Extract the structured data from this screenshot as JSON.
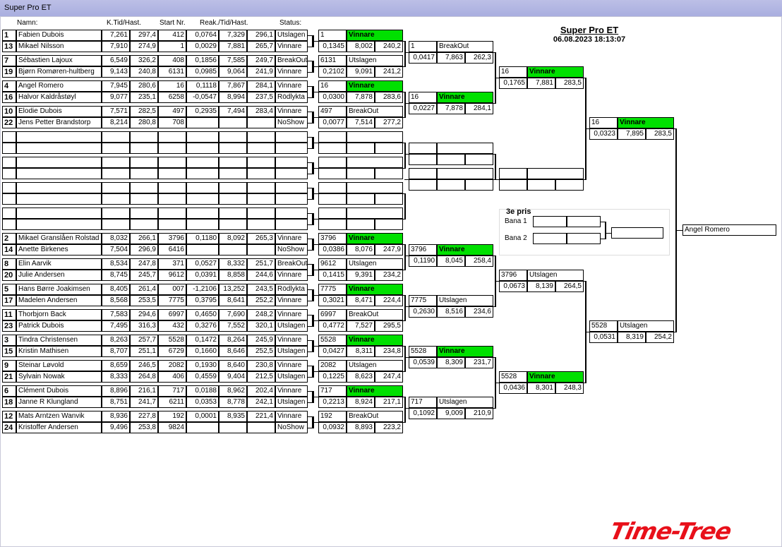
{
  "window": {
    "title": "Super Pro ET"
  },
  "headers": {
    "name": "Namn:",
    "ktid": "K.Tid/Hast.",
    "start": "Start Nr.",
    "reak": "Reak./Tid/Hast.",
    "status": "Status:"
  },
  "event": {
    "title": "Super Pro ET",
    "datetime": "06.08.2023 18:13:07"
  },
  "pairs_top": [
    [
      {
        "n": "1",
        "name": "Fabien  Dubois",
        "k": "7,261",
        "h": "297,4",
        "s": "412",
        "r": "0,0764",
        "t": "7,329",
        "sp": "296,1",
        "st": "Utslagen"
      },
      {
        "n": "13",
        "name": "Mikael Nilsson",
        "k": "7,910",
        "h": "274,9",
        "s": "1",
        "r": "0,0029",
        "t": "7,881",
        "sp": "265,7",
        "st": "Vinnare"
      }
    ],
    [
      {
        "n": "7",
        "name": "Sébastien Lajoux",
        "k": "6,549",
        "h": "326,2",
        "s": "408",
        "r": "0,1856",
        "t": "7,585",
        "sp": "249,7",
        "st": "BreakOut"
      },
      {
        "n": "19",
        "name": "Bjørn Romøren-hultberg",
        "k": "9,143",
        "h": "240,8",
        "s": "6131",
        "r": "0,0985",
        "t": "9,064",
        "sp": "241,9",
        "st": "Vinnare"
      }
    ],
    [
      {
        "n": "4",
        "name": "Angel Romero",
        "k": "7,945",
        "h": "280,6",
        "s": "16",
        "r": "0,1118",
        "t": "7,867",
        "sp": "284,1",
        "st": "Vinnare"
      },
      {
        "n": "16",
        "name": "Halvor Kaldråstøyl",
        "k": "9,077",
        "h": "235,1",
        "s": "6258",
        "r": "-0,0547",
        "t": "8,994",
        "sp": "237,5",
        "st": "Rödlykta"
      }
    ],
    [
      {
        "n": "10",
        "name": "Elodie  Dubois",
        "k": "7,571",
        "h": "282,5",
        "s": "497",
        "r": "0,2935",
        "t": "7,494",
        "sp": "283,4",
        "st": "Vinnare"
      },
      {
        "n": "22",
        "name": "Jens Petter  Brandstorp",
        "k": "8,214",
        "h": "280,8",
        "s": "708",
        "r": "",
        "t": "",
        "sp": "",
        "st": "NoShow"
      }
    ]
  ],
  "pairs_bottom": [
    [
      {
        "n": "2",
        "name": "Mikael Granslåen Rolstad",
        "k": "8,032",
        "h": "266,1",
        "s": "3796",
        "r": "0,1180",
        "t": "8,092",
        "sp": "265,3",
        "st": "Vinnare"
      },
      {
        "n": "14",
        "name": "Anette Birkenes",
        "k": "7,504",
        "h": "296,9",
        "s": "6416",
        "r": "",
        "t": "",
        "sp": "",
        "st": "NoShow"
      }
    ],
    [
      {
        "n": "8",
        "name": "Elin Aarvik",
        "k": "8,534",
        "h": "247,8",
        "s": "371",
        "r": "0,0527",
        "t": "8,332",
        "sp": "251,7",
        "st": "BreakOut"
      },
      {
        "n": "20",
        "name": "Julie  Andersen",
        "k": "8,745",
        "h": "245,7",
        "s": "9612",
        "r": "0,0391",
        "t": "8,858",
        "sp": "244,6",
        "st": "Vinnare"
      }
    ],
    [
      {
        "n": "5",
        "name": "Hans Børre Joakimsen",
        "k": "8,405",
        "h": "261,4",
        "s": "007",
        "r": "-1,2106",
        "t": "13,252",
        "sp": "243,5",
        "st": "Rödlykta"
      },
      {
        "n": "17",
        "name": "Madelen Andersen",
        "k": "8,568",
        "h": "253,5",
        "s": "7775",
        "r": "0,3795",
        "t": "8,641",
        "sp": "252,2",
        "st": "Vinnare"
      }
    ],
    [
      {
        "n": "11",
        "name": "Thorbjorn Back",
        "k": "7,583",
        "h": "294,6",
        "s": "6997",
        "r": "0,4650",
        "t": "7,690",
        "sp": "248,2",
        "st": "Vinnare"
      },
      {
        "n": "23",
        "name": "Patrick Dubois",
        "k": "7,495",
        "h": "316,3",
        "s": "432",
        "r": "0,3276",
        "t": "7,552",
        "sp": "320,1",
        "st": "Utslagen"
      }
    ],
    [
      {
        "n": "3",
        "name": "Tindra Christensen",
        "k": "8,263",
        "h": "257,7",
        "s": "5528",
        "r": "0,1472",
        "t": "8,264",
        "sp": "245,9",
        "st": "Vinnare"
      },
      {
        "n": "15",
        "name": "Kristin Mathisen",
        "k": "8,707",
        "h": "251,1",
        "s": "6729",
        "r": "0,1660",
        "t": "8,646",
        "sp": "252,5",
        "st": "Utslagen"
      }
    ],
    [
      {
        "n": "9",
        "name": "Steinar Løvold",
        "k": "8,659",
        "h": "246,5",
        "s": "2082",
        "r": "0,1930",
        "t": "8,640",
        "sp": "230,8",
        "st": "Vinnare"
      },
      {
        "n": "21",
        "name": "Sylvain Nowak",
        "k": "8,333",
        "h": "264,8",
        "s": "406",
        "r": "0,4559",
        "t": "9,404",
        "sp": "212,5",
        "st": "Utslagen"
      }
    ],
    [
      {
        "n": "6",
        "name": "Clément Dubois",
        "k": "8,896",
        "h": "216,1",
        "s": "717",
        "r": "0,0188",
        "t": "8,962",
        "sp": "202,4",
        "st": "Vinnare"
      },
      {
        "n": "18",
        "name": "Janne R Klungland",
        "k": "8,751",
        "h": "241,7",
        "s": "6211",
        "r": "0,0353",
        "t": "8,778",
        "sp": "242,1",
        "st": "Utslagen"
      }
    ],
    [
      {
        "n": "12",
        "name": "Mats Arntzen Wanvik",
        "k": "8,936",
        "h": "227,8",
        "s": "192",
        "r": "0,0001",
        "t": "8,935",
        "sp": "221,4",
        "st": "Vinnare"
      },
      {
        "n": "24",
        "name": "Kristoffer Andersen",
        "k": "9,496",
        "h": "253,8",
        "s": "9824",
        "r": "",
        "t": "",
        "sp": "",
        "st": "NoShow"
      }
    ]
  ],
  "r1_top": [
    {
      "no": "1",
      "st": "Vinnare",
      "r": "0,1345",
      "t": "8,002",
      "sp": "240,2"
    },
    {
      "no": "6131",
      "st": "Utslagen",
      "r": "0,2102",
      "t": "9,091",
      "sp": "241,2"
    },
    {
      "no": "16",
      "st": "Vinnare",
      "r": "0,0300",
      "t": "7,878",
      "sp": "283,6"
    },
    {
      "no": "497",
      "st": "BreakOut",
      "r": "0,0077",
      "t": "7,514",
      "sp": "277,2"
    }
  ],
  "r1_bottom": [
    {
      "no": "3796",
      "st": "Vinnare",
      "r": "0,0386",
      "t": "8,076",
      "sp": "247,9"
    },
    {
      "no": "9612",
      "st": "Utslagen",
      "r": "0,1415",
      "t": "9,391",
      "sp": "234,2"
    },
    {
      "no": "7775",
      "st": "Vinnare",
      "r": "0,3021",
      "t": "8,471",
      "sp": "224,4"
    },
    {
      "no": "6997",
      "st": "BreakOut",
      "r": "0,4772",
      "t": "7,527",
      "sp": "295,5"
    },
    {
      "no": "5528",
      "st": "Vinnare",
      "r": "0,0427",
      "t": "8,311",
      "sp": "234,8"
    },
    {
      "no": "2082",
      "st": "Utslagen",
      "r": "0,1225",
      "t": "8,623",
      "sp": "247,4"
    },
    {
      "no": "717",
      "st": "Vinnare",
      "r": "0,2213",
      "t": "8,924",
      "sp": "217,1"
    },
    {
      "no": "192",
      "st": "BreakOut",
      "r": "0,0932",
      "t": "8,893",
      "sp": "223,2"
    }
  ],
  "r2_top": [
    {
      "no": "1",
      "st": "BreakOut",
      "r": "0,0417",
      "t": "7,863",
      "sp": "262,3"
    },
    {
      "no": "16",
      "st": "Vinnare",
      "r": "0,0227",
      "t": "7,878",
      "sp": "284,1"
    }
  ],
  "r2_bottom": [
    {
      "no": "3796",
      "st": "Vinnare",
      "r": "0,1190",
      "t": "8,045",
      "sp": "258,4"
    },
    {
      "no": "7775",
      "st": "Utslagen",
      "r": "0,2630",
      "t": "8,516",
      "sp": "234,6"
    },
    {
      "no": "5528",
      "st": "Vinnare",
      "r": "0,0539",
      "t": "8,309",
      "sp": "231,7"
    },
    {
      "no": "717",
      "st": "Utslagen",
      "r": "0,1092",
      "t": "9,009",
      "sp": "210,9"
    }
  ],
  "r3": [
    {
      "no": "16",
      "st": "Vinnare",
      "r": "0,1765",
      "t": "7,881",
      "sp": "283,5"
    },
    {
      "no": "3796",
      "st": "Utslagen",
      "r": "0,0673",
      "t": "8,139",
      "sp": "264,5"
    },
    {
      "no": "5528",
      "st": "Vinnare",
      "r": "0,0436",
      "t": "8,301",
      "sp": "248,3"
    }
  ],
  "r4": [
    {
      "no": "16",
      "st": "Vinnare",
      "r": "0,0323",
      "t": "7,895",
      "sp": "283,5"
    },
    {
      "no": "5528",
      "st": "Utslagen",
      "r": "0,0531",
      "t": "8,319",
      "sp": "254,2"
    }
  ],
  "winner": "Angel Romero",
  "third": {
    "title": "3e pris",
    "lane1": "Bana 1",
    "lane2": "Bana 2"
  },
  "logo": "Time-Tree",
  "colors": {
    "winner_green": "#00e000",
    "titlebar": "#b4b7e3",
    "logo_red": "#e8101a"
  }
}
